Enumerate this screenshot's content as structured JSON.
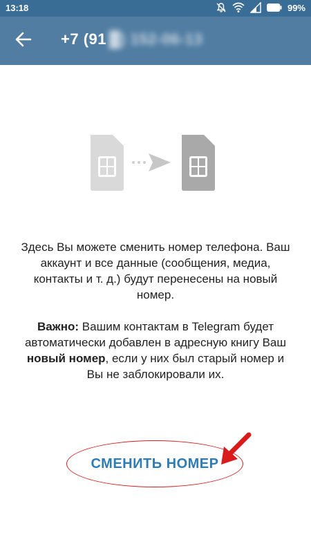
{
  "status_bar": {
    "time": "13:18",
    "battery": "99%",
    "icons": [
      "bell-muted-icon",
      "wifi-icon",
      "signal-icon",
      "battery-icon"
    ]
  },
  "app_bar": {
    "title_visible": "+7 (91",
    "title_obscured": "█) 152-06-13",
    "back_icon": "arrow-left-icon"
  },
  "illustration": {
    "icons": [
      "sim-card-old-icon",
      "dots-icon",
      "send-arrow-icon",
      "sim-card-new-icon"
    ]
  },
  "description": {
    "paragraph1": "Здесь Вы можете сменить номер телефона. Ваш аккаунт и все данные (сообщения, медиа, контакты и т. д.) будут перенесены на новый номер.",
    "important_label": "Важно:",
    "important_text_1": " Вашим контактам в Telegram будет автоматически добавлен в адресную книгу Ваш ",
    "important_bold": "новый номер",
    "important_text_2": ", если у них был старый номер и Вы не заблокировали их."
  },
  "action": {
    "change_number_label": "СМЕНИТЬ НОМЕР"
  },
  "colors": {
    "app_bar": "#517da2",
    "status_bar": "#3a6d95",
    "button_text": "#2d7cb5",
    "annotation": "#d81b1b",
    "sim_light": "#d9d9d9",
    "sim_dark": "#a9a9a9"
  }
}
